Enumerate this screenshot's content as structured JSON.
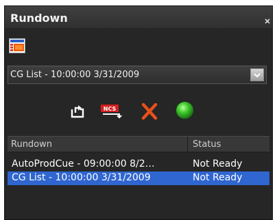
{
  "panel": {
    "title": "Rundown",
    "close_glyph": "×",
    "icons": {
      "close": "close-icon",
      "view": "rundown-view-icon"
    }
  },
  "selector": {
    "value": "CG List - 10:00:00  3/31/2009",
    "icon": "chevron-down-icon"
  },
  "toolbar": {
    "buttons": [
      {
        "icon": "export-icon"
      },
      {
        "icon": "ncs-icon",
        "label": "NCS"
      },
      {
        "icon": "delete-icon"
      },
      {
        "icon": "status-indicator-icon",
        "color": "#3ecb2d"
      }
    ]
  },
  "grid": {
    "columns": [
      "Rundown",
      "Status"
    ],
    "rows": [
      {
        "name": "AutoProdCue - 09:00:00  8/2…",
        "status": "Not Ready",
        "selected": false
      },
      {
        "name": "CG List - 10:00:00  3/31/2009",
        "status": "Not Ready",
        "selected": true
      }
    ]
  },
  "colors": {
    "panel_bg": "#262626",
    "selection": "#2f66d0",
    "delete": "#e8501a",
    "status_ok": "#3ecb2d"
  }
}
